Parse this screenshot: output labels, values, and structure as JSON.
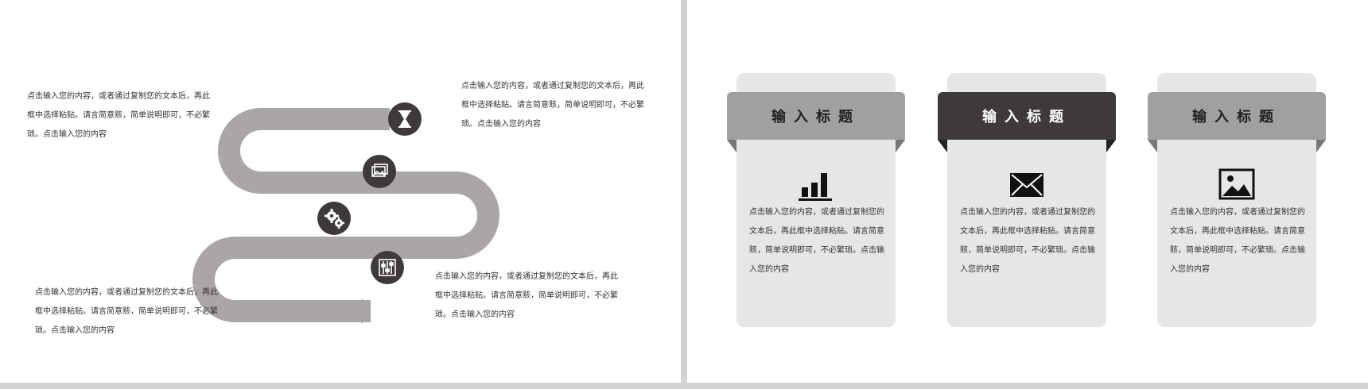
{
  "left_slide": {
    "paragraphs": [
      "点击输入您的内容，或者通过复制您的文本后，再此\n框中选择粘贴。请言简意赅，简单说明即可，不必繁\n琐。点击输入您的内容",
      "点击输入您的内容，或者通过复制您的文本后，再此\n框中选择粘贴。请言简意赅，简单说明即可，不必繁\n琐。点击输入您的内容",
      "点击输入您的内容，或者通过复制您的文本后，再此\n框中选择粘贴。请言简意赅，简单说明即可，不必繁\n琐。点击输入您的内容",
      "点击输入您的内容，或者通过复制您的文本后，再此\n框中选择粘贴。请言简意赅，简单说明即可，不必繁\n琐。点击输入您的内容"
    ],
    "milestones": [
      {
        "icon": "hourglass-icon"
      },
      {
        "icon": "image-icon"
      },
      {
        "icon": "gears-icon"
      },
      {
        "icon": "sliders-icon"
      }
    ],
    "colors": {
      "road": "#aaa6a6",
      "badge": "#3e3a3a"
    }
  },
  "right_slide": {
    "cards": [
      {
        "title": "输入标题",
        "icon": "bar-chart-icon",
        "banner_color": "#a0a0a0",
        "title_color": "#222222",
        "text": "点击输入您的内容，或者通过复制您的文本后，再此框中选择粘贴。请言简意赅，简单说明即可，不必繁琐。点击输入您的内容"
      },
      {
        "title": "输入标题",
        "icon": "envelope-icon",
        "banner_color": "#3e3a3a",
        "title_color": "#ffffff",
        "text": "点击输入您的内容，或者通过复制您的文本后，再此框中选择粘贴。请言简意赅，简单说明即可，不必繁琐。点击输入您的内容"
      },
      {
        "title": "输入标题",
        "icon": "picture-icon",
        "banner_color": "#a0a0a0",
        "title_color": "#222222",
        "text": "点击输入您的内容，或者通过复制您的文本后，再此框中选择粘贴。请言简意赅，简单说明即可，不必繁琐。点击输入您的内容"
      }
    ],
    "colors": {
      "card_bg": "#e6e6e6"
    }
  }
}
